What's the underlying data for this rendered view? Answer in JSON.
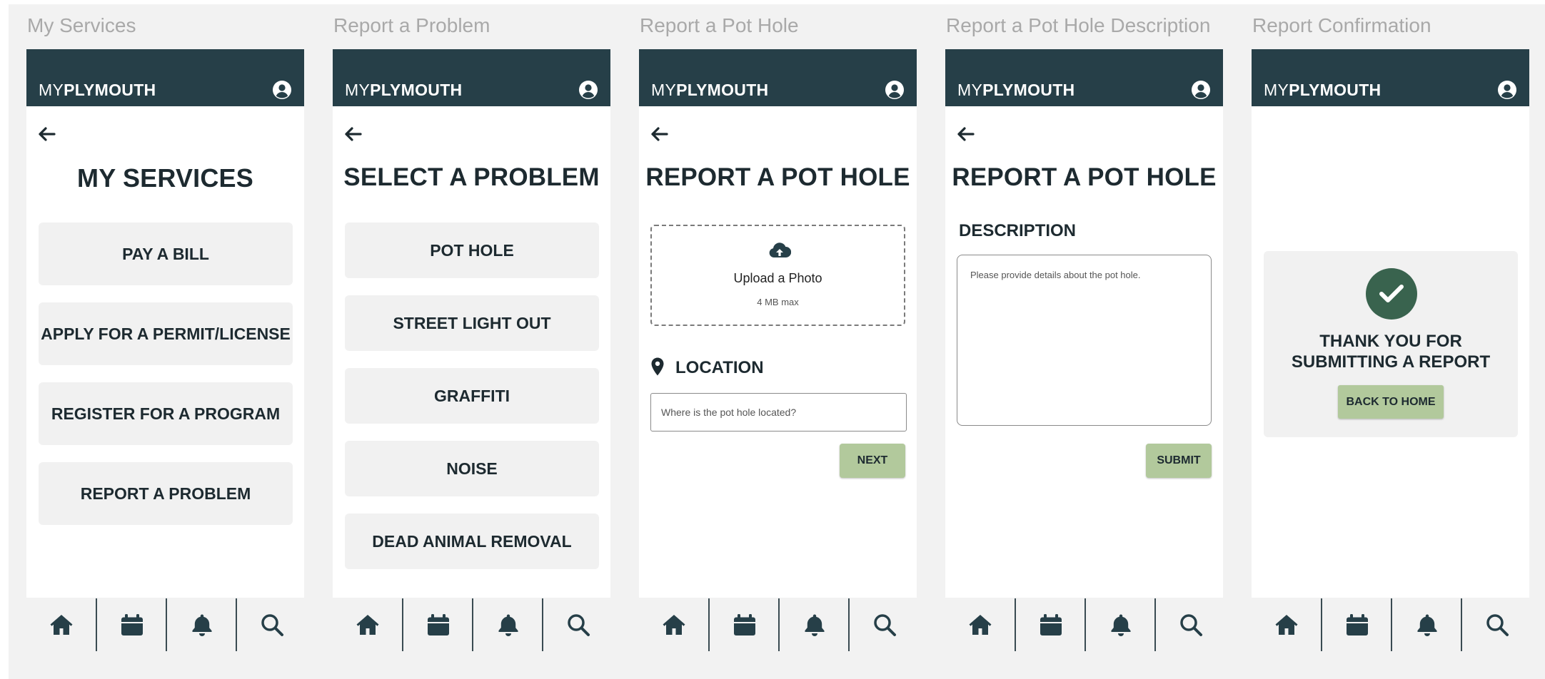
{
  "colors": {
    "header": "#263f48",
    "text_dark": "#1d2a30",
    "button_bg": "#f1f1f1",
    "action_green": "#b2c99c",
    "check_green": "#39634e",
    "canvas_bg": "#f2f2f2",
    "label_gray": "#a9a9a9"
  },
  "brand": {
    "prefix": "MY",
    "name": "PLYMOUTH"
  },
  "icons": {
    "user": "user-circle-icon",
    "back": "arrow-left-icon",
    "upload": "cloud-upload-icon",
    "location": "map-pin-icon",
    "check": "check-icon",
    "tabs": [
      "home-icon",
      "calendar-icon",
      "bell-icon",
      "search-icon"
    ]
  },
  "screens": {
    "services": {
      "frame_label": "My Services",
      "title": "MY SERVICES",
      "buttons": [
        "PAY A BILL",
        "APPLY FOR A PERMIT/LICENSE",
        "REGISTER FOR A PROGRAM",
        "REPORT A PROBLEM"
      ]
    },
    "problem": {
      "frame_label": "Report a Problem",
      "title": "SELECT A PROBLEM",
      "buttons": [
        "POT HOLE",
        "STREET LIGHT OUT",
        "GRAFFITI",
        "NOISE",
        "DEAD ANIMAL REMOVAL"
      ]
    },
    "pothole": {
      "frame_label": "Report a Pot Hole",
      "title": "REPORT A POT HOLE",
      "upload_label": "Upload a Photo",
      "upload_sub": "4 MB max",
      "location_heading": "LOCATION",
      "location_placeholder": "Where is the pot hole located?",
      "next_label": "NEXT"
    },
    "description": {
      "frame_label": "Report a Pot Hole Description",
      "title": "REPORT A POT HOLE",
      "description_heading": "DESCRIPTION",
      "description_placeholder": "Please provide details about the pot hole.",
      "submit_label": "SUBMIT"
    },
    "confirmation": {
      "frame_label": "Report Confirmation",
      "message_line1": "THANK YOU FOR",
      "message_line2": "SUBMITTING A REPORT",
      "home_label": "BACK TO HOME"
    }
  }
}
